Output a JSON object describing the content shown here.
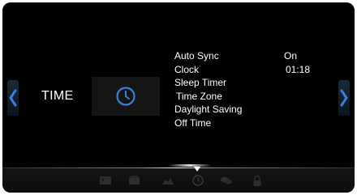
{
  "section": {
    "title": "TIME",
    "icon": "clock-icon"
  },
  "menu": {
    "items": [
      {
        "label": "Auto Sync",
        "value": "On"
      },
      {
        "label": "Clock",
        "value": "01:18"
      },
      {
        "label": "Sleep Timer"
      },
      {
        "label": "Time Zone"
      },
      {
        "label": "Daylight Saving"
      },
      {
        "label": "Off Time"
      }
    ]
  },
  "navigation": {
    "prev_icon": "chevron-left-icon",
    "next_icon": "chevron-right-icon"
  },
  "bottom_tabs": {
    "icons": [
      "picture-icon",
      "sound-icon",
      "setup-icon",
      "time-icon",
      "option-icon",
      "lock-icon"
    ],
    "selected": "time-icon"
  },
  "colors": {
    "background": "#000000",
    "text": "#ffffff",
    "accent": "#3b7fd9"
  }
}
